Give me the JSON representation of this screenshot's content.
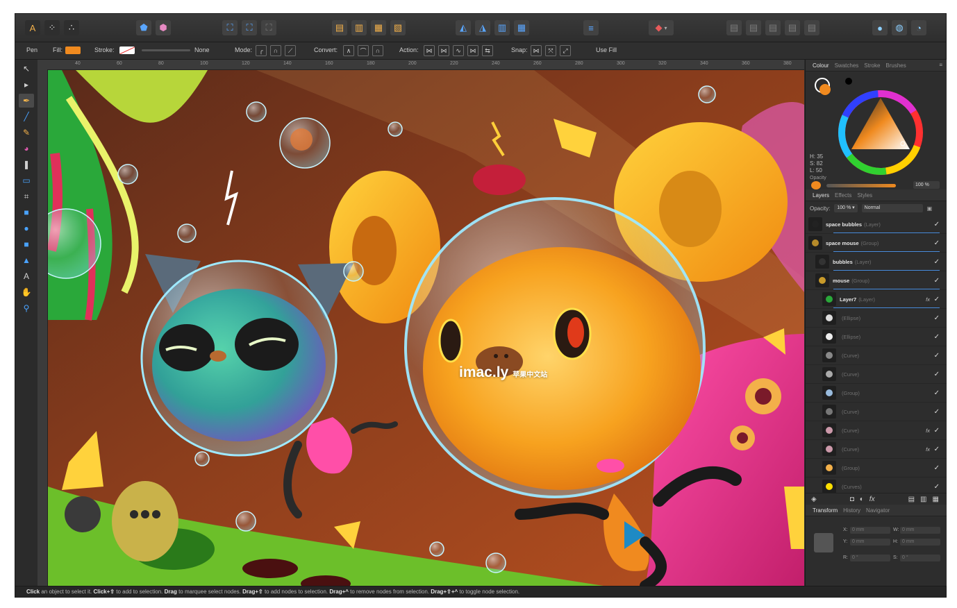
{
  "toolbar": {
    "personas": [
      "A",
      "⁘",
      "∴"
    ],
    "groups": [
      {
        "icons": [
          "⬟",
          "⬢"
        ]
      },
      {
        "icons": [
          "⛶",
          "⛶",
          "⛶"
        ]
      },
      {
        "icons": [
          "▤",
          "▥",
          "▦",
          "▧"
        ]
      },
      {
        "icons": [
          "◭",
          "◮",
          "▥",
          "▦"
        ]
      },
      {
        "icons": [
          "≡"
        ]
      },
      {
        "icons": [
          "▾"
        ]
      },
      {
        "icons": [
          "▤",
          "▤",
          "▤",
          "▤",
          "▤"
        ]
      },
      {
        "icons": [
          "●",
          "◍",
          "◔"
        ]
      }
    ]
  },
  "context": {
    "tool_label": "Pen",
    "fill_label": "Fill:",
    "stroke_label": "Stroke:",
    "stroke_value": "None",
    "mode_label": "Mode:",
    "convert_label": "Convert:",
    "action_label": "Action:",
    "snap_label": "Snap:",
    "use_fill_label": "Use Fill",
    "colors": {
      "fill": "#f08a1f"
    }
  },
  "tools": [
    "↖",
    "▸",
    "✒",
    "╱",
    "✎",
    "◕",
    "❚",
    "▭",
    "⌗",
    "■",
    "●",
    "■",
    "▲",
    "A",
    "✋",
    "⚲"
  ],
  "ruler": {
    "ticks": [
      "40",
      "60",
      "80",
      "100",
      "120",
      "140",
      "160",
      "180",
      "200",
      "220",
      "240",
      "260",
      "280",
      "300",
      "320",
      "340",
      "360",
      "380"
    ]
  },
  "panel": {
    "colour_tabs": [
      "Colour",
      "Swatches",
      "Stroke",
      "Brushes"
    ],
    "hsl": {
      "h": "H: 35",
      "s": "S: 82",
      "l": "L: 50"
    },
    "opacity_label": "Opacity",
    "opacity_value": "100 %",
    "layer_tabs": [
      "Layers",
      "Effects",
      "Styles"
    ],
    "layer_opacity_label": "Opacity:",
    "layer_opacity_value": "100 % ▾",
    "blend_mode": "Normal",
    "layers": [
      {
        "name": "space bubbles",
        "type": "(Layer)",
        "fx": "",
        "check": "✓"
      },
      {
        "name": "space mouse",
        "type": "(Group)",
        "fx": "",
        "check": "✓"
      },
      {
        "name": "bubbles",
        "type": "(Layer)",
        "fx": "",
        "check": "✓"
      },
      {
        "name": "mouse",
        "type": "(Group)",
        "fx": "",
        "check": "✓"
      },
      {
        "name": "Layer7",
        "type": "(Layer)",
        "fx": "fx",
        "check": "✓"
      },
      {
        "name": "",
        "type": "(Ellipse)",
        "fx": "",
        "check": "✓"
      },
      {
        "name": "",
        "type": "(Ellipse)",
        "fx": "",
        "check": "✓"
      },
      {
        "name": "",
        "type": "(Curve)",
        "fx": "",
        "check": "✓"
      },
      {
        "name": "",
        "type": "(Curve)",
        "fx": "",
        "check": "✓"
      },
      {
        "name": "",
        "type": "(Group)",
        "fx": "",
        "check": "✓"
      },
      {
        "name": "",
        "type": "(Curve)",
        "fx": "",
        "check": "✓"
      },
      {
        "name": "",
        "type": "(Curve)",
        "fx": "fx",
        "check": "✓"
      },
      {
        "name": "",
        "type": "(Curve)",
        "fx": "fx",
        "check": "✓"
      },
      {
        "name": "",
        "type": "(Group)",
        "fx": "",
        "check": "✓"
      },
      {
        "name": "",
        "type": "(Curves)",
        "fx": "",
        "check": "✓"
      },
      {
        "name": "",
        "type": "(Curve)",
        "fx": "",
        "check": "✓"
      }
    ],
    "transform_tabs": [
      "Transform",
      "History",
      "Navigator"
    ],
    "transform": {
      "x_label": "X:",
      "y_label": "Y:",
      "w_label": "W:",
      "h_label": "H:",
      "r_label": "R:",
      "s_label": "S:",
      "x": "0 mm",
      "y": "0 mm",
      "w": "0 mm",
      "h": "0 mm",
      "r": "0 °",
      "s": "0 °"
    }
  },
  "status": {
    "p1_b": "Click",
    "p1": " an object to select it. ",
    "p2_b": "Click+⇧",
    "p2": " to add to selection. ",
    "p3_b": "Drag",
    "p3": " to marquee select nodes. ",
    "p4_b": "Drag+⇧",
    "p4": " to add nodes to selection. ",
    "p5_b": "Drag+^",
    "p5": " to remove nodes from selection. ",
    "p6_b": "Drag+⇧+^",
    "p6": " to toggle node selection."
  },
  "watermark": {
    "main": "imac.ly",
    "sub": "苹果中文站"
  }
}
